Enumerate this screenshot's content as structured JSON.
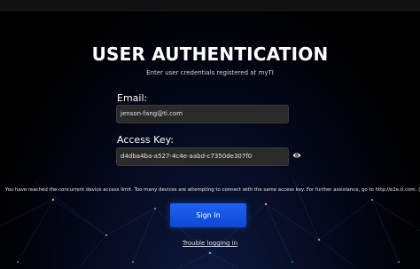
{
  "header": {
    "title": "USER AUTHENTICATION",
    "subtitle": "Enter user credentials registered at myTI"
  },
  "form": {
    "email_label": "Email:",
    "email_value": "jenson-fang@ti.com",
    "access_key_label": "Access Key:",
    "access_key_value": "d4dba4ba-a527-4c4e-aabd-c7350de307f0",
    "show_key_icon": "eye-icon"
  },
  "warning": {
    "text": "You have reached the concurrent device access limit. Too many devices are attempting to connect with the same access key. For further assistance, go to http://e2e.ti.com. (-"
  },
  "actions": {
    "signin_label": "Sign In",
    "trouble_label": "Trouble logging in"
  },
  "colors": {
    "background": "#000000",
    "accent": "#1f5ff0",
    "field": "#2a2a2a"
  }
}
